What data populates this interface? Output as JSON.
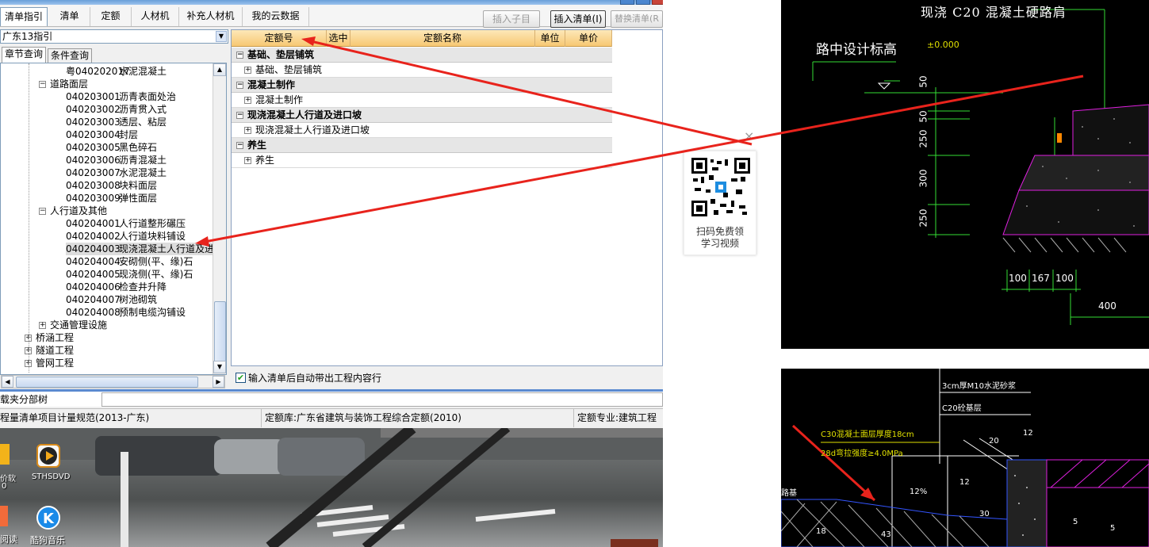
{
  "toolbar": {
    "tabs": [
      "清单指引",
      "清单",
      "定额",
      "人材机",
      "补充人材机",
      "我的云数据"
    ],
    "insert_child": "插入子目",
    "insert_list": "插入清单(I)",
    "replace_list": "替换清单(R"
  },
  "left": {
    "region_select": "广东13指引",
    "subtabs": [
      "章节查询",
      "条件查询"
    ],
    "tree": [
      {
        "code": "粤040202017",
        "name": "水泥混凝土"
      },
      {
        "group": "道路面层",
        "expanded": true
      },
      {
        "code": "040203001",
        "name": "沥青表面处治"
      },
      {
        "code": "040203002",
        "name": "沥青贯入式"
      },
      {
        "code": "040203003",
        "name": "透层、粘层"
      },
      {
        "code": "040203004",
        "name": "封层"
      },
      {
        "code": "040203005",
        "name": "黑色碎石"
      },
      {
        "code": "040203006",
        "name": "沥青混凝土"
      },
      {
        "code": "040203007",
        "name": "水泥混凝土"
      },
      {
        "code": "040203008",
        "name": "块料面层"
      },
      {
        "code": "040203009",
        "name": "弹性面层"
      },
      {
        "group": "人行道及其他",
        "expanded": true
      },
      {
        "code": "040204001",
        "name": "人行道整形碾压"
      },
      {
        "code": "040204002",
        "name": "人行道块料铺设"
      },
      {
        "code": "040204003",
        "name": "现浇混凝土人行道及进",
        "selected": true
      },
      {
        "code": "040204004",
        "name": "安砌侧(平、缘)石"
      },
      {
        "code": "040204005",
        "name": "现浇侧(平、缘)石"
      },
      {
        "code": "040204006",
        "name": "检查井升降"
      },
      {
        "code": "040204007",
        "name": "树池砌筑"
      },
      {
        "code": "040204008",
        "name": "预制电缆沟铺设"
      },
      {
        "group": "交通管理设施",
        "expanded": false
      },
      {
        "root": "桥涵工程"
      },
      {
        "root": "隧道工程"
      },
      {
        "root": "管网工程"
      }
    ]
  },
  "grid": {
    "headers": [
      "定额号",
      "选中",
      "定额名称",
      "单位",
      "单价"
    ],
    "rows": [
      {
        "type": "group",
        "label": "基础、垫层铺筑"
      },
      {
        "type": "item",
        "label": "基础、垫层铺筑"
      },
      {
        "type": "group",
        "label": "混凝土制作"
      },
      {
        "type": "item",
        "label": "混凝土制作"
      },
      {
        "type": "group",
        "label": "现浇混凝土人行道及进口坡"
      },
      {
        "type": "item",
        "label": "现浇混凝土人行道及进口坡"
      },
      {
        "type": "group",
        "label": "养生"
      },
      {
        "type": "item",
        "label": "养生"
      }
    ],
    "auto_bring": "输入清单后自动带出工程内容行",
    "auto_bring_checked": true
  },
  "bottom_tabs": [
    "载夹",
    "分部树"
  ],
  "status": {
    "spec": "程量清单项目计量规范(2013-广东)",
    "quota_lib": "定额库:广东省建筑与装饰工程综合定额(2010)",
    "quota_major": "定额专业:建筑工程"
  },
  "desktop": {
    "icons": [
      {
        "label": "STHSDVD"
      },
      {
        "label": "酷狗音乐"
      }
    ],
    "partial_labels": [
      "价软",
      "0",
      "阅读"
    ]
  },
  "qr_popup": {
    "line1": "扫码免费领",
    "line2": "学习视频",
    "close": "×"
  },
  "cad1": {
    "title": "现浇 C20 混凝土硬路肩",
    "design_label": "路中设计标高",
    "elev": "±0.000",
    "dims_v": [
      "50",
      "50",
      "250",
      "300",
      "250"
    ],
    "dims_h": [
      "100",
      "167",
      "100",
      "400"
    ]
  },
  "cad2": {
    "notes": [
      "3cm厚M10水泥砂浆",
      "C20砼基层",
      "C30混凝土面层厚度18cm",
      "28d弯拉强度≥4.0MPa"
    ],
    "side": "路基",
    "dims": [
      "12%",
      "12",
      "20",
      "12",
      "30",
      "5",
      "5",
      "18",
      "43"
    ]
  },
  "colors": {
    "arrow": "#e8231c",
    "cad_green": "#33dd33",
    "cad_magenta": "#e020e0",
    "cad_yellow": "#e0e000",
    "header_orange": "#f7c873"
  }
}
